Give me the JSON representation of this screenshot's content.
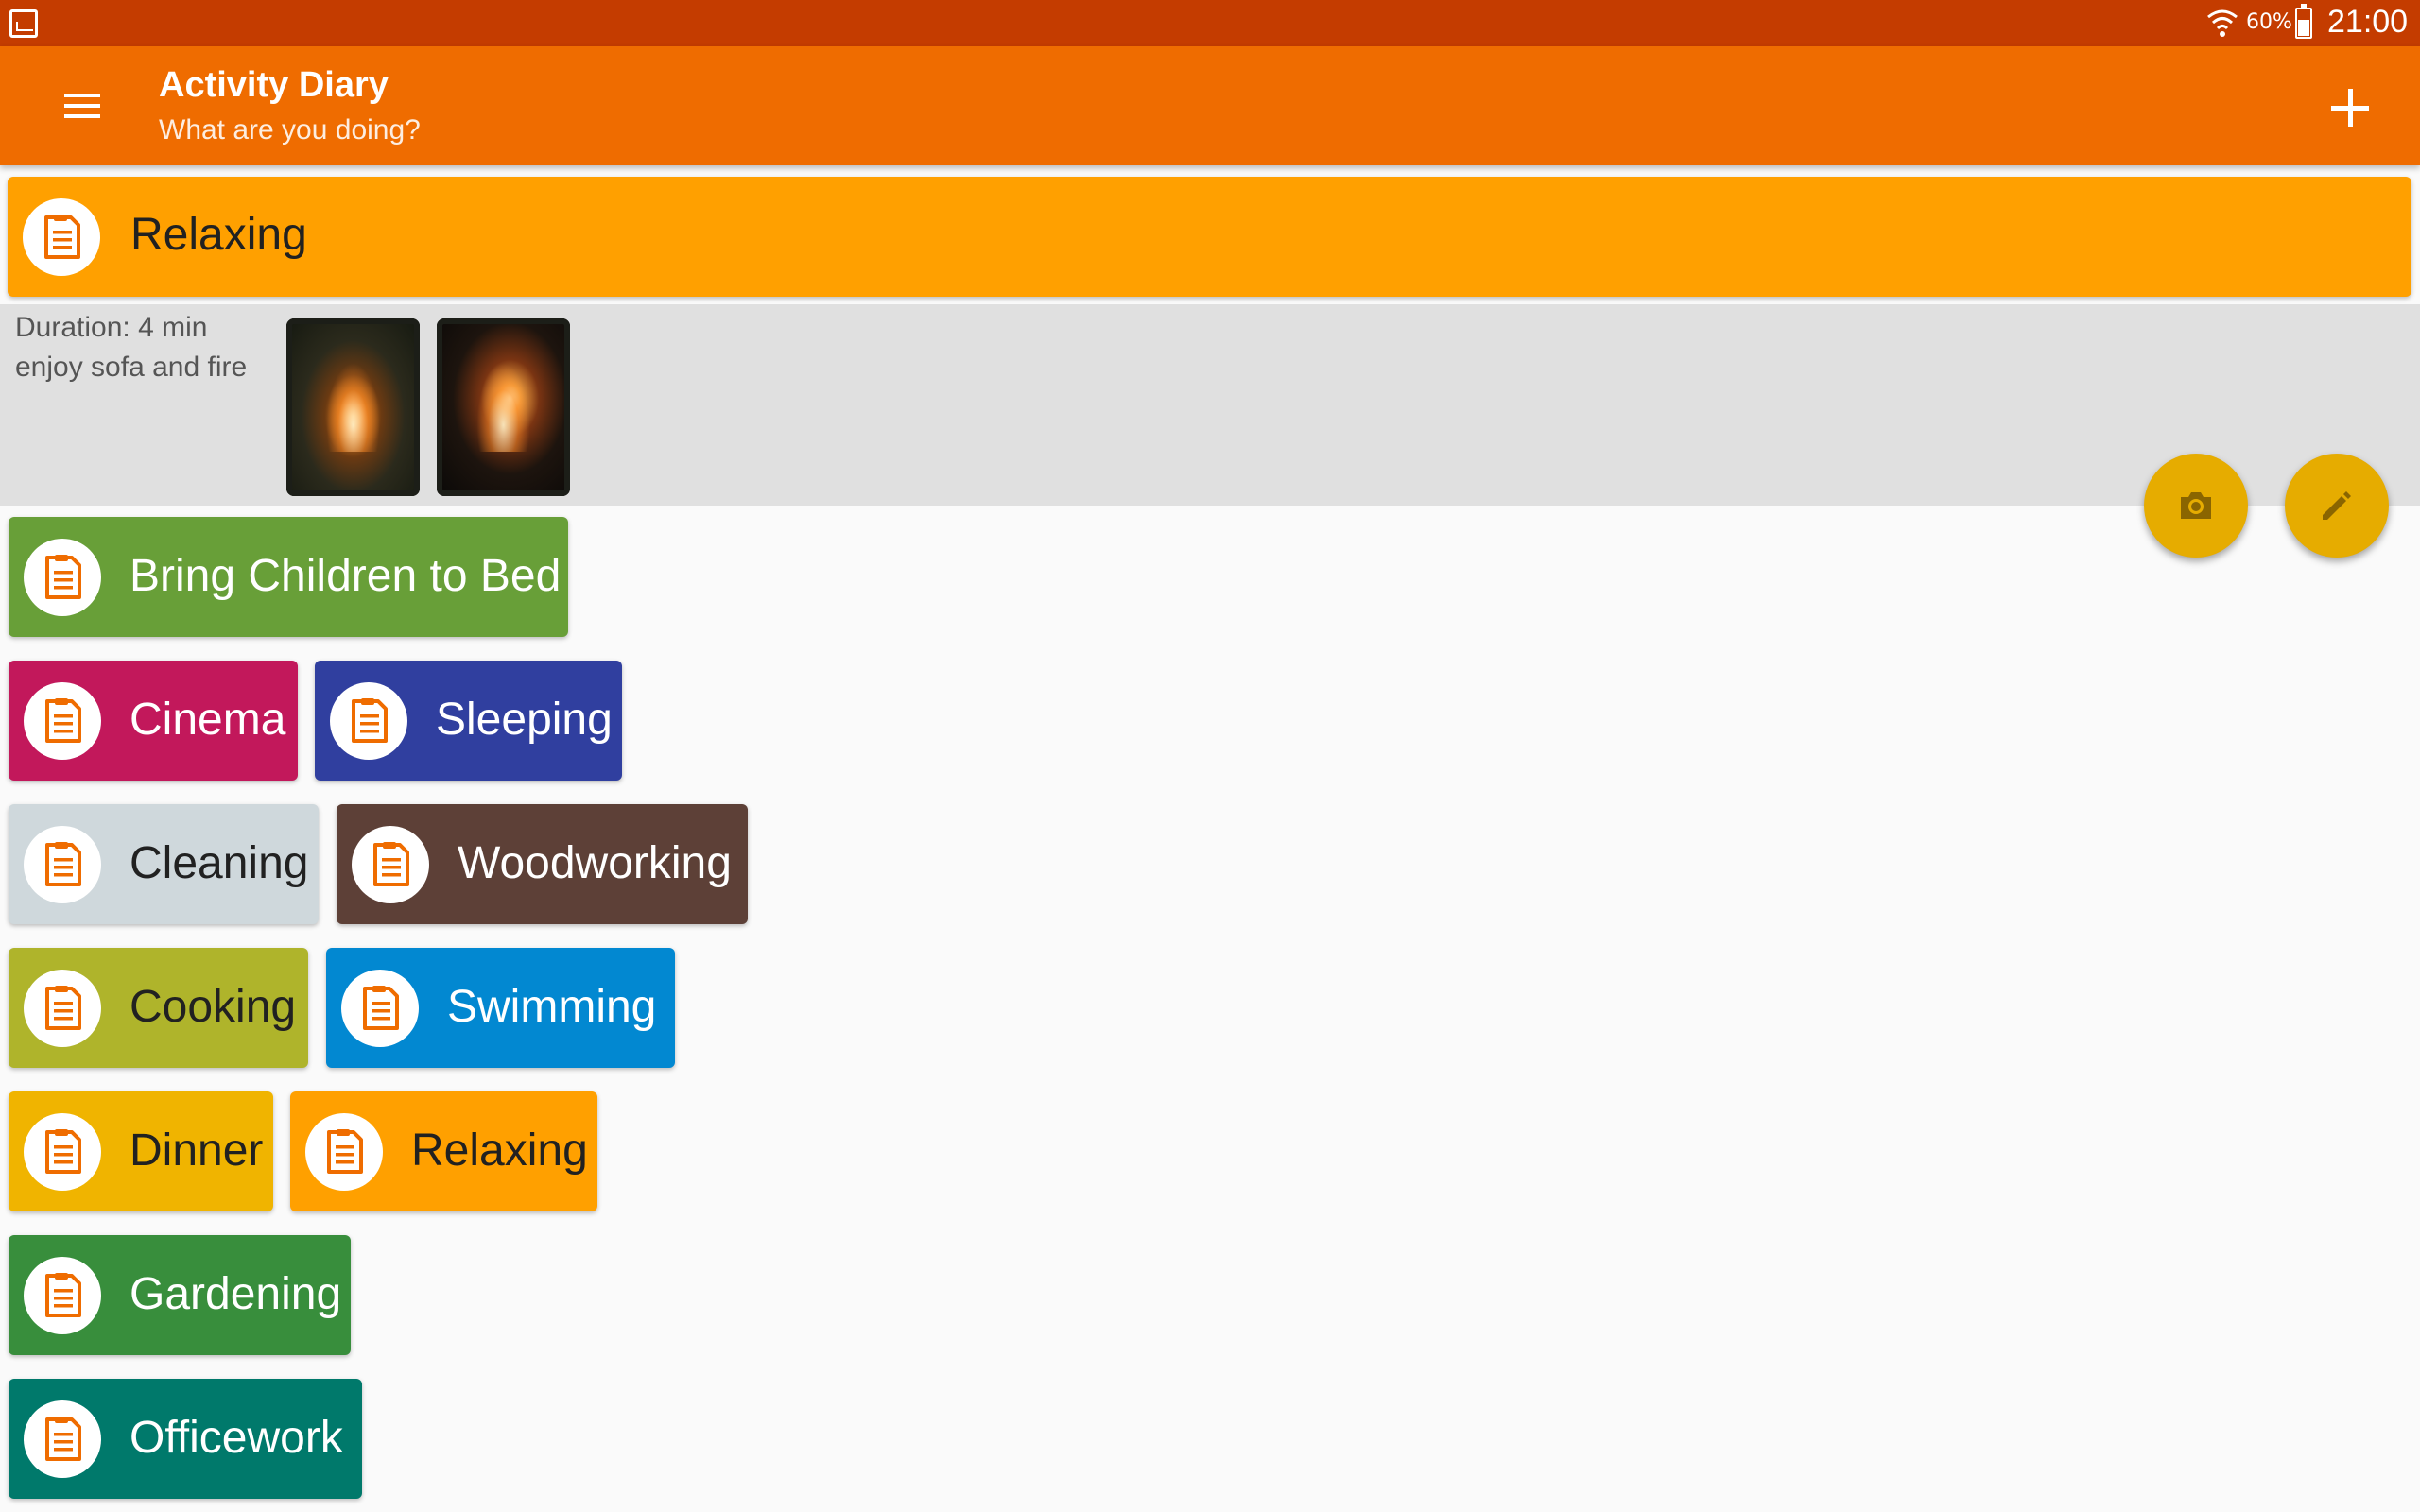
{
  "status_bar": {
    "battery_text": "60%",
    "time": "21:00",
    "icons": [
      "gallery-icon",
      "wifi-icon",
      "battery-icon"
    ]
  },
  "app_bar": {
    "title": "Activity Diary",
    "subtitle": "What are you doing?",
    "icons": [
      "menu-icon",
      "add-icon"
    ]
  },
  "current_activity": {
    "name": "Relaxing",
    "color": "#ffa000",
    "duration": "Duration: 4 min",
    "note": "enjoy sofa and fire",
    "photos": [
      "fireplace-photo-1",
      "fireplace-photo-2"
    ]
  },
  "fabs": {
    "icons": [
      "camera-icon",
      "edit-pencil-icon"
    ],
    "color": "#e6ac00"
  },
  "activities": [
    {
      "name": "Bring Children to Bed",
      "color": "#689f38",
      "text_color": "#ffffff"
    },
    {
      "name": "Cinema",
      "color": "#c2185b",
      "text_color": "#ffffff"
    },
    {
      "name": "Sleeping",
      "color": "#303f9f",
      "text_color": "#ffffff"
    },
    {
      "name": "Cleaning",
      "color": "#cfd8dc",
      "text_color": "#212121"
    },
    {
      "name": "Woodworking",
      "color": "#5d4037",
      "text_color": "#ffffff"
    },
    {
      "name": "Cooking",
      "color": "#afb42b",
      "text_color": "#212121"
    },
    {
      "name": "Swimming",
      "color": "#0288d1",
      "text_color": "#ffffff"
    },
    {
      "name": "Dinner",
      "color": "#f0b400",
      "text_color": "#212121"
    },
    {
      "name": "Relaxing",
      "color": "#ffa000",
      "text_color": "#212121"
    },
    {
      "name": "Gardening",
      "color": "#388e3c",
      "text_color": "#ffffff"
    },
    {
      "name": "Officework",
      "color": "#00796b",
      "text_color": "#ffffff"
    }
  ],
  "activity_icon": "clipboard-icon",
  "accent": "#ef6c00"
}
